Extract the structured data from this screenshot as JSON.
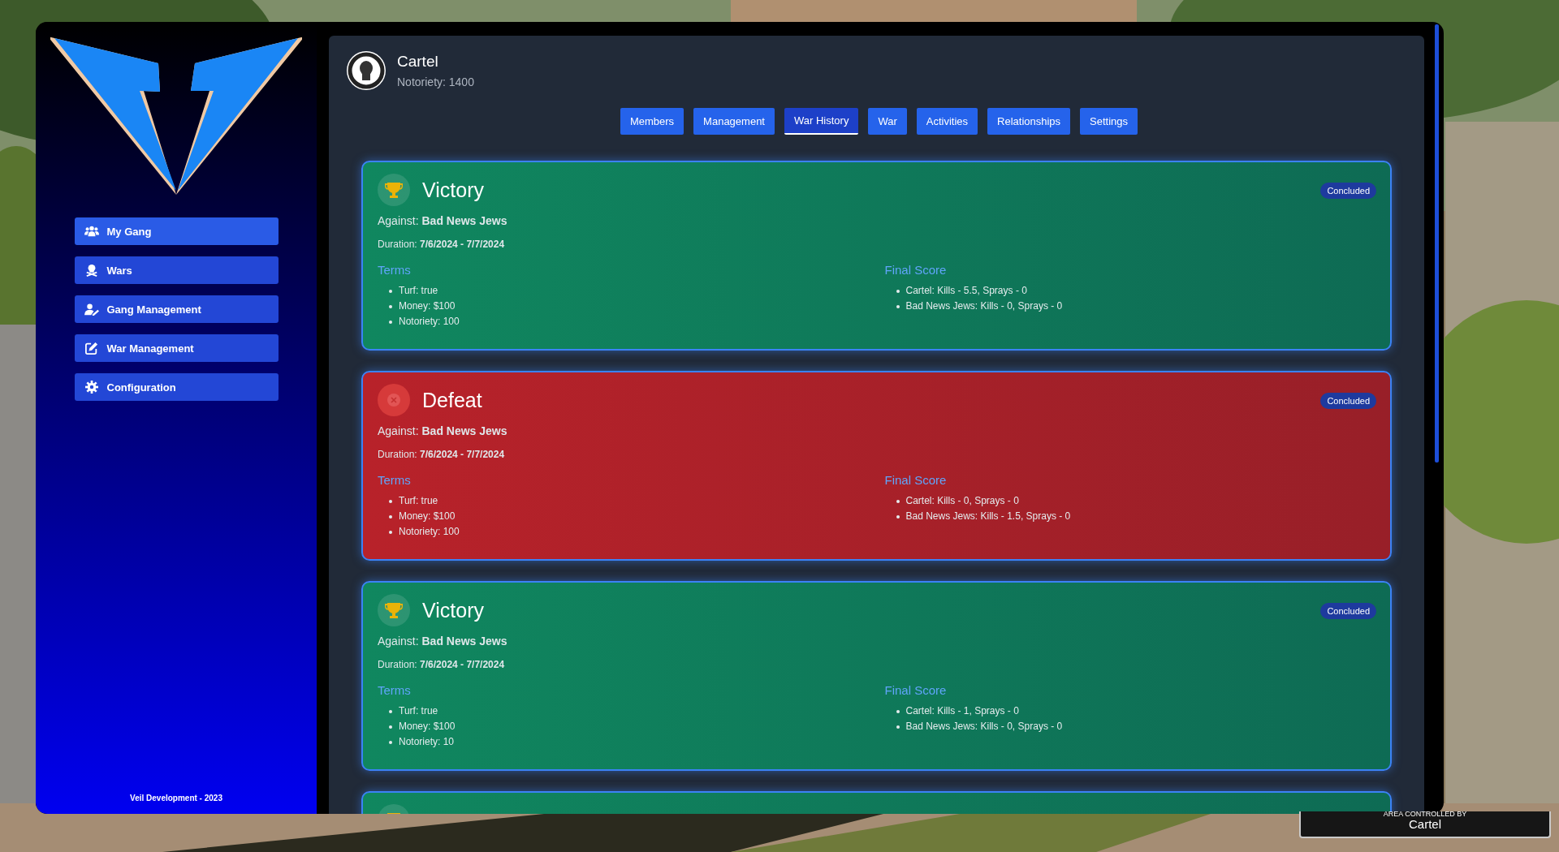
{
  "sidebar": {
    "items": [
      {
        "label": "My Gang",
        "selected": true
      },
      {
        "label": "Wars",
        "selected": false
      },
      {
        "label": "Gang Management",
        "selected": false
      },
      {
        "label": "War Management",
        "selected": false
      },
      {
        "label": "Configuration",
        "selected": false
      }
    ],
    "footer": "Veil Development - 2023"
  },
  "gang": {
    "name": "Cartel",
    "notoriety": "Notoriety: 1400"
  },
  "tabs": [
    {
      "label": "Members",
      "selected": false
    },
    {
      "label": "Management",
      "selected": false
    },
    {
      "label": "War History",
      "selected": true
    },
    {
      "label": "War",
      "selected": false
    },
    {
      "label": "Activities",
      "selected": false
    },
    {
      "label": "Relationships",
      "selected": false
    },
    {
      "label": "Settings",
      "selected": false
    }
  ],
  "wars": [
    {
      "kind": "victory",
      "title": "Victory",
      "status": "Concluded",
      "against": "Against: **Bad News Jews**",
      "duration": "Duration: **7/6/2024 - 7/7/2024**",
      "terms_heading": "Terms",
      "terms": [
        "Turf: true",
        "Money: $100",
        "Notoriety: 100"
      ],
      "score_heading": "Final Score",
      "scores": [
        "Cartel: Kills - 5.5, Sprays - 0",
        "Bad News Jews: Kills - 0, Sprays - 0"
      ]
    },
    {
      "kind": "defeat",
      "title": "Defeat",
      "status": "Concluded",
      "against": "Against: **Bad News Jews**",
      "duration": "Duration: **7/6/2024 - 7/7/2024**",
      "terms_heading": "Terms",
      "terms": [
        "Turf: true",
        "Money: $100",
        "Notoriety: 100"
      ],
      "score_heading": "Final Score",
      "scores": [
        "Cartel: Kills - 0, Sprays - 0",
        "Bad News Jews: Kills - 1.5, Sprays - 0"
      ]
    },
    {
      "kind": "victory",
      "title": "Victory",
      "status": "Concluded",
      "against": "Against: **Bad News Jews**",
      "duration": "Duration: **7/6/2024 - 7/7/2024**",
      "terms_heading": "Terms",
      "terms": [
        "Turf: true",
        "Money: $100",
        "Notoriety: 10"
      ],
      "score_heading": "Final Score",
      "scores": [
        "Cartel: Kills - 1, Sprays - 0",
        "Bad News Jews: Kills - 0, Sprays - 0"
      ]
    },
    {
      "kind": "victory"
    }
  ],
  "hud": {
    "caption": "AREA CONTROLLED BY",
    "owner": "Cartel"
  }
}
